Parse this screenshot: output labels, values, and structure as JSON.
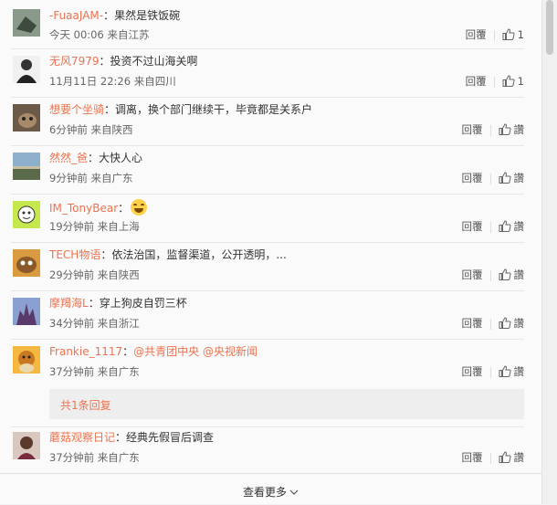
{
  "comments": [
    {
      "user": "-FuaaJAM-",
      "text": "：果然是铁饭碗",
      "meta": "今天 00:06 来自江苏",
      "reply": "回覆",
      "like": "1",
      "avatar_color": "#6a7a6a"
    },
    {
      "user": "无风7979",
      "text": "：投资不过山海关啊",
      "meta": "11月11日 22:26 来自四川",
      "reply": "回覆",
      "like": "1",
      "avatar_color": "#2a2a2a"
    },
    {
      "user": "想要个坐骑",
      "text": "：调离，换个部门继续干，毕竟都是关系户",
      "meta": "6分钟前 来自陕西",
      "reply": "回覆",
      "like": "讚",
      "avatar_color": "#5a4a3a"
    },
    {
      "user": "然然_爸",
      "text": "：大快人心",
      "meta": "9分钟前 来自广东",
      "reply": "回覆",
      "like": "讚",
      "avatar_color": "#5f7f9a"
    },
    {
      "user": "IM_TonyBear",
      "text": "：",
      "meta": "19分钟前 来自上海",
      "reply": "回覆",
      "like": "讚",
      "avatar_color": "#b8e04a"
    },
    {
      "user": "TECH物语",
      "text": "：依法治国，监督渠道，公开透明，...",
      "meta": "29分钟前 来自陕西",
      "reply": "回覆",
      "like": "讚",
      "avatar_color": "#c98a3a"
    },
    {
      "user": "摩羯海L",
      "text": "：穿上狗皮自罚三杯",
      "meta": "34分钟前 来自浙江",
      "reply": "回覆",
      "like": "讚",
      "avatar_color": "#7a6aa0"
    },
    {
      "user": "Frankie_1117",
      "text": "：",
      "mention1": "@共青团中央",
      "mention2": "@央视新闻",
      "meta": "37分钟前 来自广东",
      "reply": "回覆",
      "like": "讚",
      "avatar_color": "#e8a030"
    },
    {
      "user": "蘑菇观察日记",
      "text": "：经典先假冒后调查",
      "meta": "37分钟前 来自广东",
      "reply": "回覆",
      "like": "讚",
      "avatar_color": "#6a4a4a"
    }
  ],
  "subreplies_label": "共1条回复",
  "see_more_label": "查看更多"
}
